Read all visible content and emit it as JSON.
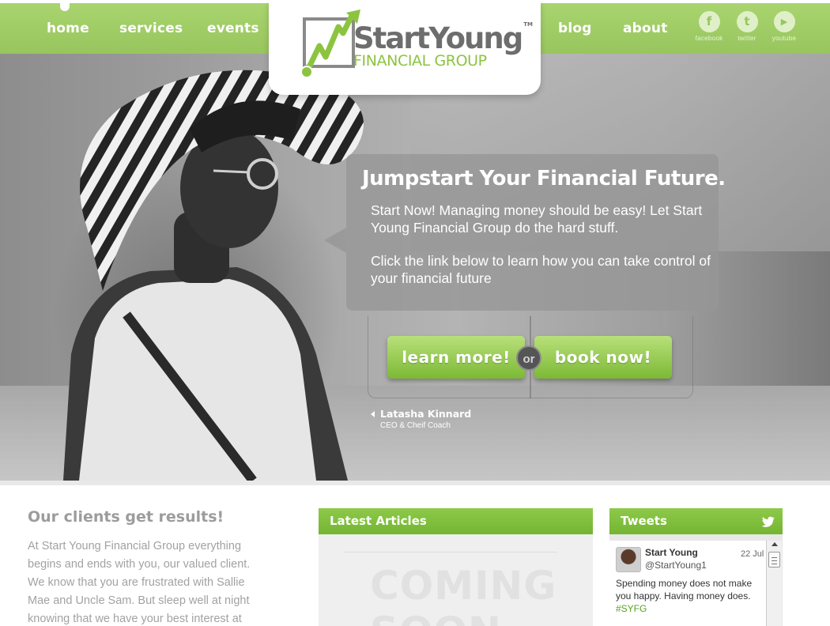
{
  "nav": {
    "left_items": [
      {
        "label": "home"
      },
      {
        "label": "services"
      },
      {
        "label": "events"
      }
    ],
    "right_items": [
      {
        "label": "blog"
      },
      {
        "label": "about"
      }
    ],
    "social": [
      {
        "label": "facebook",
        "glyph": "f",
        "icon": "facebook-icon"
      },
      {
        "label": "twitter",
        "glyph": "t",
        "icon": "twitter-icon"
      },
      {
        "label": "youtube",
        "glyph": "▶",
        "icon": "youtube-icon"
      }
    ]
  },
  "logo": {
    "line1": "StartYoung",
    "tm": "TM",
    "line2": "FINANCIAL GROUP"
  },
  "hero": {
    "title": "Jumpstart Your Financial Future.",
    "paragraph1": "Start Now! Managing money should be easy! Let Start Young Financial Group do the hard stuff.",
    "paragraph2": "Click the link below to learn how you can take control of your financial future",
    "learn_more": "learn more!",
    "or": "or",
    "book_now": "book now!",
    "person_name": "Latasha Kinnard",
    "person_role": "CEO & Cheif Coach"
  },
  "clients": {
    "title": "Our clients get results!",
    "text": "At Start Young Financial Group everything begins and ends with you, our valued client. We know that you are frustrated with Sallie Mae and Uncle Sam. But sleep well at night knowing that we have your best interest at"
  },
  "articles": {
    "title": "Latest Articles",
    "placeholder": "COMING SOON"
  },
  "tweets": {
    "title": "Tweets",
    "name": "Start Young",
    "handle": "@StartYoung1",
    "date": "22 Jul",
    "text": "Spending money does not make you happy. Having money does.",
    "hashtag": "#SYFG"
  },
  "colors": {
    "brand_green": "#8cc440",
    "nav_green": "#a9d46f",
    "gray_text": "#9c9c9c"
  }
}
